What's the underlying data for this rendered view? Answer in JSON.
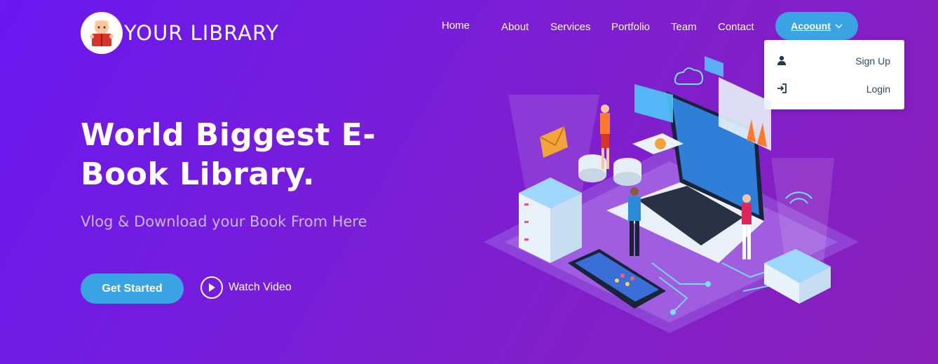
{
  "brand": {
    "name": "YOUR LIBRARY",
    "logo_icon": "kid-reading-book-icon"
  },
  "nav": {
    "items": [
      "Home",
      "About",
      "Services",
      "Portfolio",
      "Team",
      "Contact"
    ],
    "account_label": "Acoount",
    "account_icon": "chevron-down-icon"
  },
  "account_menu": {
    "items": [
      {
        "label": "Sign Up",
        "icon": "user-icon"
      },
      {
        "label": "Login",
        "icon": "login-icon"
      }
    ]
  },
  "hero": {
    "title": "World Biggest E-Book Library.",
    "subtitle": "Vlog & Download your Book From Here",
    "cta_label": "Get Started",
    "video_label": "Watch Video",
    "illustration": "isometric-laptop-servers-illustration"
  },
  "colors": {
    "accent": "#3aa3e3",
    "background_start": "#6a17f0",
    "background_end": "#8a1fb8",
    "menu_text": "#2c4964"
  }
}
